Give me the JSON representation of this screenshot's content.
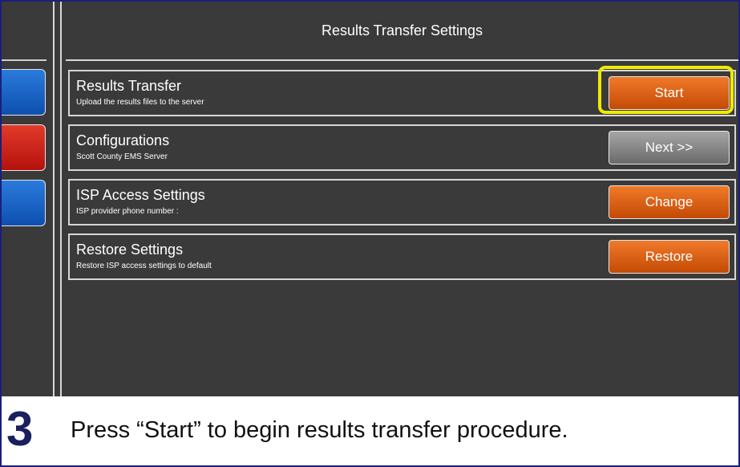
{
  "header": {
    "title": "Results Transfer Settings"
  },
  "rows": [
    {
      "title": "Results Transfer",
      "subtitle": "Upload the results files to the server",
      "button_label": "Start",
      "button_style": "orange"
    },
    {
      "title": "Configurations",
      "subtitle": "Scott County EMS Server",
      "button_label": "Next >>",
      "button_style": "gray"
    },
    {
      "title": "ISP Access Settings",
      "subtitle": "ISP provider phone number :",
      "button_label": "Change",
      "button_style": "orange"
    },
    {
      "title": "Restore Settings",
      "subtitle": "Restore ISP access settings to default",
      "button_label": "Restore",
      "button_style": "orange"
    }
  ],
  "side_buttons": [
    "blue",
    "red",
    "blue"
  ],
  "instruction": {
    "step_number": "3",
    "text": "Press “Start” to begin results transfer procedure."
  },
  "colors": {
    "orange": "#e0620f",
    "gray": "#8a8a8a",
    "highlight": "#f0ea00",
    "screen_bg": "#3a3a3a",
    "side_blue": "#1a64c8",
    "side_red": "#d22219"
  }
}
